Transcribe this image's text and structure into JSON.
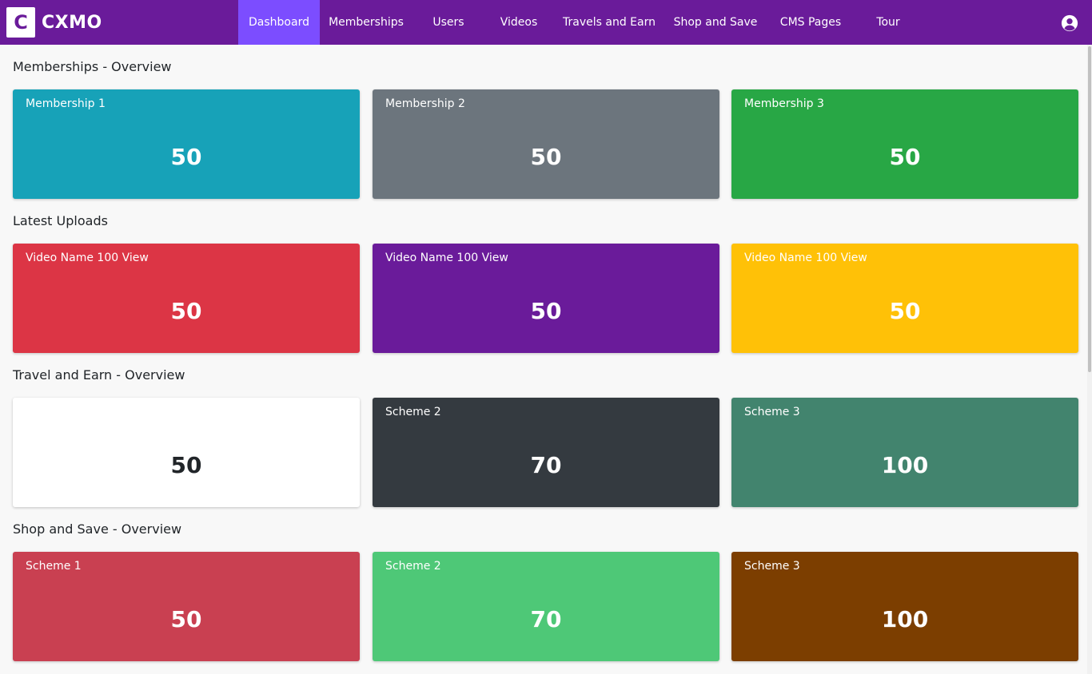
{
  "brand": {
    "logo_letter": "C",
    "name": "CXMO"
  },
  "nav": {
    "items": [
      {
        "label": "Dashboard",
        "active": true
      },
      {
        "label": "Memberships"
      },
      {
        "label": "Users"
      },
      {
        "label": "Videos"
      },
      {
        "label": "Travels and Earn"
      },
      {
        "label": "Shop and Save"
      },
      {
        "label": "CMS Pages"
      },
      {
        "label": "Tour"
      }
    ],
    "account_icon": "account-circle-icon"
  },
  "sections": [
    {
      "title": "Memberships - Overview",
      "cards": [
        {
          "label": "Membership 1",
          "value": "50",
          "color": "#17a2b8"
        },
        {
          "label": "Membership 2",
          "value": "50",
          "color": "#6c757d"
        },
        {
          "label": "Membership 3",
          "value": "50",
          "color": "#28a745"
        }
      ]
    },
    {
      "title": "Latest Uploads",
      "cards": [
        {
          "label": "Video Name 100 View",
          "value": "50",
          "color": "#dc3545"
        },
        {
          "label": "Video Name 100 View",
          "value": "50",
          "color": "#6a1b9a"
        },
        {
          "label": "Video Name 100 View",
          "value": "50",
          "color": "#ffc107"
        }
      ]
    },
    {
      "title": "Travel and Earn - Overview",
      "cards": [
        {
          "label": "",
          "value": "50",
          "color": "#ffffff",
          "text_color": "#212529"
        },
        {
          "label": "Scheme 2",
          "value": "70",
          "color": "#343a40"
        },
        {
          "label": "Scheme 3",
          "value": "100",
          "color": "#42846e"
        }
      ]
    },
    {
      "title": "Shop and Save - Overview",
      "cards": [
        {
          "label": "Scheme 1",
          "value": "50",
          "color": "#c94051"
        },
        {
          "label": "Scheme 2",
          "value": "70",
          "color": "#4ec877"
        },
        {
          "label": "Scheme 3",
          "value": "100",
          "color": "#7c3e00"
        }
      ]
    }
  ]
}
